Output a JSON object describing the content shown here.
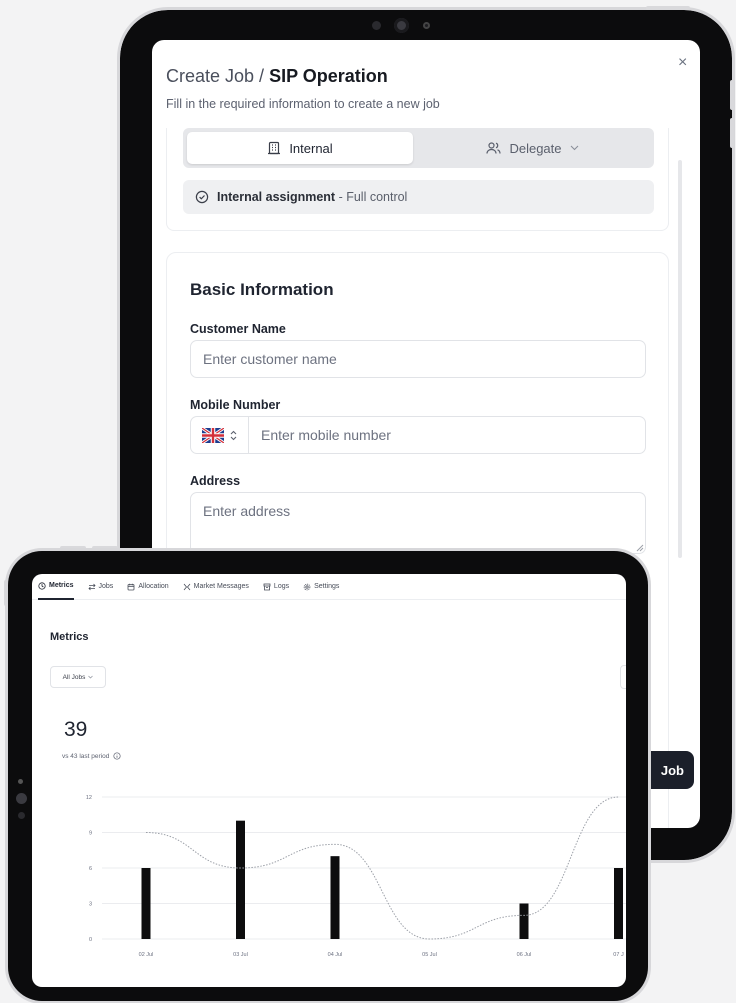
{
  "create_job": {
    "title_prefix": "Create Job /",
    "title_main": "SIP Operation",
    "subtitle": "Fill in the required information to create a new job",
    "close_glyph": "×",
    "segments": {
      "internal": "Internal",
      "delegate": "Delegate"
    },
    "assignment": {
      "bold": "Internal assignment",
      "rest": " - Full control"
    },
    "basic_information": {
      "heading": "Basic Information",
      "customer_name_label": "Customer Name",
      "customer_name_placeholder": "Enter customer name",
      "mobile_label": "Mobile Number",
      "mobile_placeholder": "Enter mobile number",
      "address_label": "Address",
      "address_placeholder": "Enter address"
    },
    "submit_label": "Job"
  },
  "metrics_app": {
    "tabs": [
      {
        "label": "Metrics",
        "icon": "clock-icon",
        "active": true
      },
      {
        "label": "Jobs",
        "icon": "arrows-icon",
        "active": false
      },
      {
        "label": "Allocation",
        "icon": "calendar-icon",
        "active": false
      },
      {
        "label": "Market Messages",
        "icon": "split-icon",
        "active": false
      },
      {
        "label": "Logs",
        "icon": "box-icon",
        "active": false
      },
      {
        "label": "Settings",
        "icon": "gear-icon",
        "active": false
      }
    ],
    "page_title": "Metrics",
    "filter_label": "All Jobs",
    "big_number": "39",
    "comparison": "vs 43 last period"
  },
  "chart_data": {
    "type": "bar",
    "categories": [
      "02 Jul",
      "03 Jul",
      "04 Jul",
      "05 Jul",
      "06 Jul",
      "07 J"
    ],
    "values": [
      6,
      10,
      7,
      0,
      3,
      6
    ],
    "trend": [
      9,
      6,
      8,
      0,
      2,
      12
    ],
    "yticks": [
      0,
      3,
      6,
      9,
      12
    ],
    "ylim": [
      0,
      12
    ],
    "grid": true,
    "colors": {
      "bar": "#0d0d0e",
      "trend": "#9ca0a8",
      "grid": "#e4e6ea"
    }
  }
}
